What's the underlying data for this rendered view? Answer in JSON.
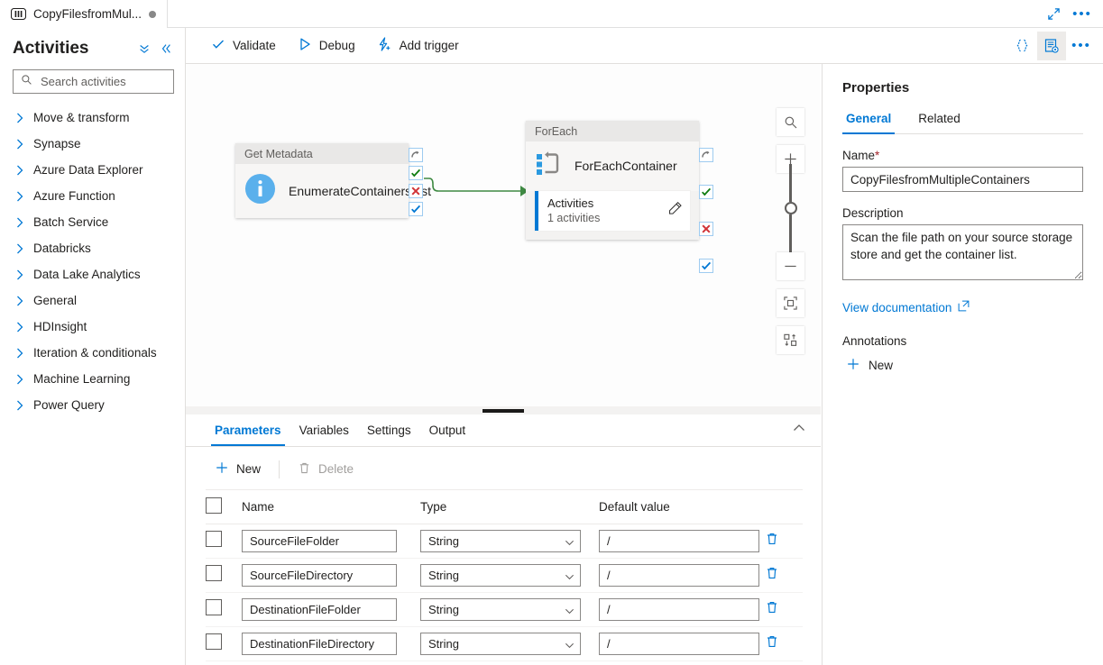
{
  "tab": {
    "icon": "pipeline-icon",
    "title": "CopyFilesfromMul...",
    "dirty_dot": "●",
    "expand_icon": "expand-diagonal-icon",
    "more_icon": "more-ellipsis-icon"
  },
  "activities_panel": {
    "title": "Activities",
    "collapse_all_icon": "double-chevron-down-icon",
    "collapse_panel_icon": "double-chevron-left-icon",
    "search": {
      "placeholder": "Search activities",
      "value": "",
      "icon": "search-icon"
    },
    "items": [
      {
        "label": "Move & transform"
      },
      {
        "label": "Synapse"
      },
      {
        "label": "Azure Data Explorer"
      },
      {
        "label": "Azure Function"
      },
      {
        "label": "Batch Service"
      },
      {
        "label": "Databricks"
      },
      {
        "label": "Data Lake Analytics"
      },
      {
        "label": "General"
      },
      {
        "label": "HDInsight"
      },
      {
        "label": "Iteration & conditionals"
      },
      {
        "label": "Machine Learning"
      },
      {
        "label": "Power Query"
      }
    ]
  },
  "toolbar": {
    "validate": "Validate",
    "debug": "Debug",
    "add_trigger": "Add trigger",
    "code_icon": "curly-braces-code-icon",
    "properties_icon": "properties-panel-icon",
    "more_icon": "more-ellipsis-icon"
  },
  "canvas": {
    "nodes": [
      {
        "type_label": "Get Metadata",
        "name": "EnumerateContainersList",
        "icon": "info-circle-icon",
        "connectors": [
          "skip-connector",
          "success-connector",
          "failure-connector",
          "completion-connector"
        ]
      },
      {
        "type_label": "ForEach",
        "name": "ForEachContainer",
        "icon": "foreach-loop-icon",
        "inner_card": {
          "title": "Activities",
          "subtitle": "1 activities",
          "edit_icon": "pencil-edit-icon"
        },
        "connectors": [
          "skip-connector",
          "success-connector",
          "failure-connector",
          "completion-connector"
        ]
      }
    ],
    "edge_color": "#3f8a43",
    "zoom_controls": {
      "search_icon": "zoom-search-icon",
      "zoom_in_icon": "plus-icon",
      "zoom_out_icon": "minus-icon",
      "fit_icon": "zoom-to-fit-icon",
      "autoalign_icon": "auto-align-icon"
    }
  },
  "bottom_panel": {
    "tabs": [
      {
        "label": "Parameters",
        "selected": true
      },
      {
        "label": "Variables",
        "selected": false
      },
      {
        "label": "Settings",
        "selected": false
      },
      {
        "label": "Output",
        "selected": false
      }
    ],
    "collapse_icon": "chevron-up-icon",
    "commands": {
      "new": "New",
      "new_icon": "plus-icon",
      "delete": "Delete",
      "delete_icon": "trash-icon"
    },
    "table": {
      "columns": [
        "Name",
        "Type",
        "Default value"
      ],
      "rows": [
        {
          "checked": false,
          "name": "SourceFileFolder",
          "type": "String",
          "default": "/",
          "delete_icon": "trash-icon"
        },
        {
          "checked": false,
          "name": "SourceFileDirectory",
          "type": "String",
          "default": "/",
          "delete_icon": "trash-icon"
        },
        {
          "checked": false,
          "name": "DestinationFileFolder",
          "type": "String",
          "default": "/",
          "delete_icon": "trash-icon"
        },
        {
          "checked": false,
          "name": "DestinationFileDirectory",
          "type": "String",
          "default": "/",
          "delete_icon": "trash-icon"
        }
      ]
    }
  },
  "properties": {
    "title": "Properties",
    "tabs": [
      {
        "label": "General",
        "selected": true
      },
      {
        "label": "Related",
        "selected": false
      }
    ],
    "name_label": "Name",
    "name_required": "*",
    "name_value": "CopyFilesfromMultipleContainers",
    "description_label": "Description",
    "description_value": "Scan the file path on your source storage store and get the container list.",
    "doc_link": "View documentation",
    "doc_link_icon": "external-link-icon",
    "annotations_label": "Annotations",
    "annotations_new": "New",
    "annotations_new_icon": "plus-icon"
  },
  "colors": {
    "accent": "#0078d4",
    "success": "#107c10",
    "error": "#d13438",
    "edge": "#3f8a43"
  }
}
